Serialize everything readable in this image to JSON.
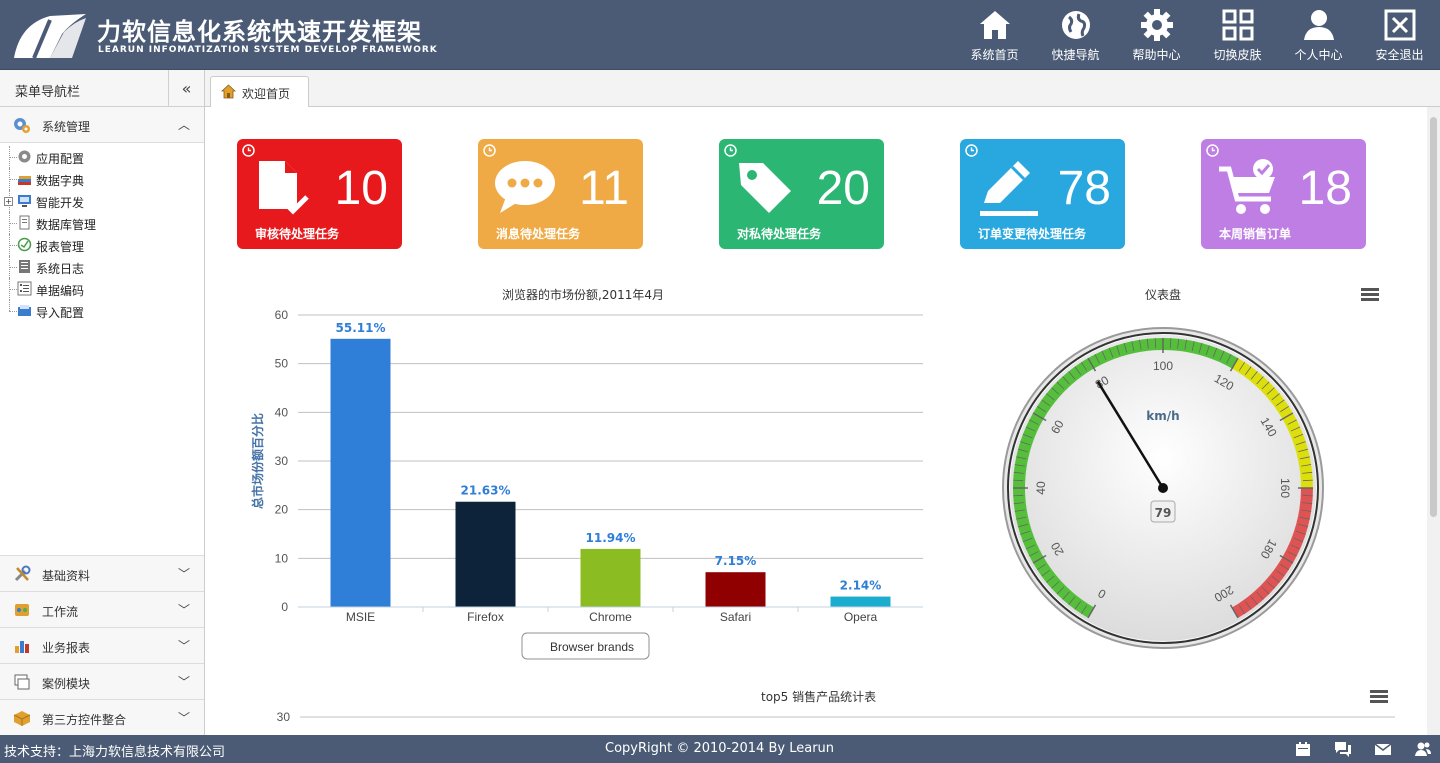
{
  "header": {
    "title_cn": "力软信息化系统快速开发框架",
    "title_en": "LEARUN INFOMATIZATION SYSTEM DEVELOP FRAMEWORK",
    "nav": [
      {
        "label": "系统首页",
        "icon": "home-icon"
      },
      {
        "label": "快捷导航",
        "icon": "globe-icon"
      },
      {
        "label": "帮助中心",
        "icon": "gear-icon"
      },
      {
        "label": "切换皮肤",
        "icon": "grid-icon"
      },
      {
        "label": "个人中心",
        "icon": "user-icon"
      },
      {
        "label": "安全退出",
        "icon": "exit-icon"
      }
    ]
  },
  "sidebar": {
    "title": "菜单导航栏",
    "active_group": "系统管理",
    "items": [
      {
        "label": "应用配置"
      },
      {
        "label": "数据字典"
      },
      {
        "label": "智能开发"
      },
      {
        "label": "数据库管理"
      },
      {
        "label": "报表管理"
      },
      {
        "label": "系统日志"
      },
      {
        "label": "单据编码"
      },
      {
        "label": "导入配置"
      }
    ],
    "groups": [
      {
        "label": "基础资料"
      },
      {
        "label": "工作流"
      },
      {
        "label": "业务报表"
      },
      {
        "label": "案例模块"
      },
      {
        "label": "第三方控件整合"
      }
    ]
  },
  "tabs": [
    {
      "label": "欢迎首页"
    }
  ],
  "tiles": [
    {
      "count": "10",
      "label": "审核待处理任务",
      "color": "#e8191c",
      "icon": "document-check-icon"
    },
    {
      "count": "11",
      "label": "消息待处理任务",
      "color": "#efaa45",
      "icon": "chat-bubble-icon"
    },
    {
      "count": "20",
      "label": "对私待处理任务",
      "color": "#2bb673",
      "icon": "tag-icon"
    },
    {
      "count": "78",
      "label": "订单变更待处理任务",
      "color": "#29a8e0",
      "icon": "pencil-icon"
    },
    {
      "count": "18",
      "label": "本周销售订单",
      "color": "#be7ee4",
      "icon": "cart-icon"
    }
  ],
  "chart_data": [
    {
      "type": "bar",
      "title": "浏览器的市场份额,2011年4月",
      "ylabel": "总市场份额百分比",
      "xlabel": "",
      "categories": [
        "MSIE",
        "Firefox",
        "Chrome",
        "Safari",
        "Opera"
      ],
      "values": [
        55.11,
        21.63,
        11.94,
        7.15,
        2.14
      ],
      "data_labels": [
        "55.11%",
        "21.63%",
        "11.94%",
        "7.15%",
        "2.14%"
      ],
      "colors": [
        "#2f7ed8",
        "#0d233a",
        "#8bbc21",
        "#910000",
        "#1aadce"
      ],
      "ylim": [
        0,
        60
      ],
      "yticks": [
        "0",
        "10",
        "20",
        "30",
        "40",
        "50",
        "60"
      ],
      "legend": {
        "label": "Browser brands",
        "position": "bottom"
      },
      "grid": true
    },
    {
      "type": "gauge",
      "title": "仪表盘",
      "unit": "km/h",
      "value": 79,
      "value_label": "79",
      "min": 0,
      "max": 200,
      "tick_labels": [
        "0",
        "20",
        "40",
        "60",
        "80",
        "100",
        "120",
        "140",
        "160",
        "180",
        "200"
      ],
      "bands": [
        {
          "from": 0,
          "to": 120,
          "color": "#55bf3b"
        },
        {
          "from": 120,
          "to": 160,
          "color": "#dddf0d"
        },
        {
          "from": 160,
          "to": 200,
          "color": "#df5353"
        }
      ]
    },
    {
      "type": "bar",
      "title": "top5 销售产品统计表",
      "yticks": [
        "30"
      ]
    }
  ],
  "footer": {
    "support": "技术支持：上海力软信息技术有限公司",
    "copyright": "CopyRight © 2010-2014 By Learun",
    "icons": [
      "calendar-icon",
      "chat-icon",
      "mail-icon",
      "users-icon"
    ]
  }
}
